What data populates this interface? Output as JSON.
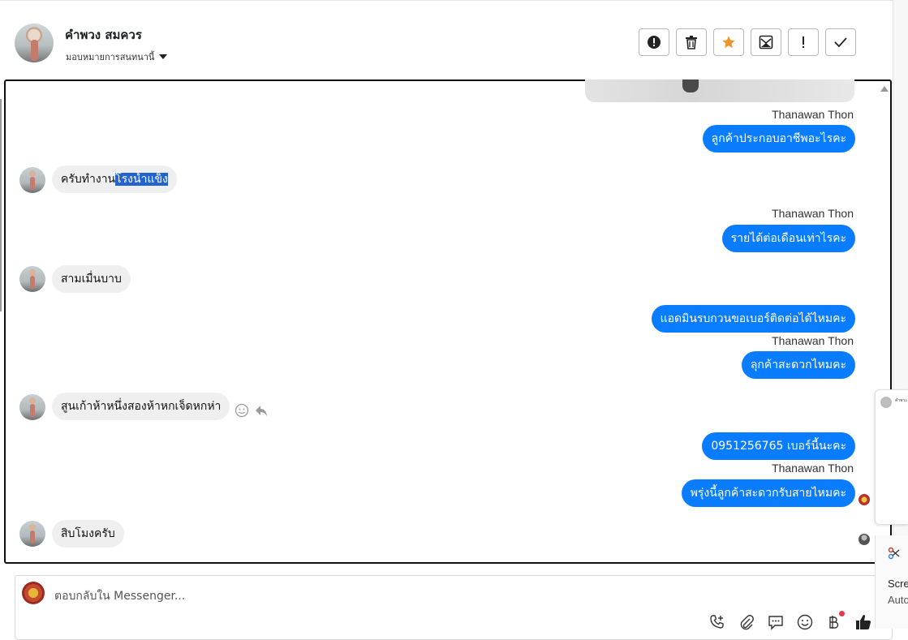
{
  "header": {
    "contact_name": "คำพวง สมควร",
    "assign_label": "มอบหมายการสนทนานี้",
    "toolbar": [
      {
        "name": "report-icon",
        "label": "!"
      },
      {
        "name": "trash-icon"
      },
      {
        "name": "star-icon",
        "color": "#f0932b"
      },
      {
        "name": "mark-unread-icon"
      },
      {
        "name": "exclamation-icon",
        "label": "!"
      },
      {
        "name": "check-icon"
      }
    ]
  },
  "messages": [
    {
      "type": "image",
      "direction": "out"
    },
    {
      "direction": "out",
      "sender": "Thanawan Thon",
      "text": "ลูกค้าประกอบอาชีพอะไรคะ"
    },
    {
      "direction": "in",
      "text_before": "ครับทำงาน",
      "text_selected": "โรงน้ำแข็ง"
    },
    {
      "direction": "out",
      "sender": "Thanawan Thon",
      "text": "รายได้ต่อเดือนเท่าไรคะ"
    },
    {
      "direction": "in",
      "text": "สามเมื่นบาบ"
    },
    {
      "direction": "out",
      "text": "แอดมินรบกวนขอเบอร์ติดต่อได้ไหมคะ"
    },
    {
      "direction": "out",
      "sender": "Thanawan Thon",
      "text": "ลุกค้าสะดวกไหมคะ"
    },
    {
      "direction": "in",
      "text": "สูนเก้าห้าหนึ่งสองห้าหกเจ็ดหกห่า"
    },
    {
      "direction": "out",
      "text": "0951256765 เบอร์นี้นะคะ"
    },
    {
      "direction": "out",
      "sender": "Thanawan Thon",
      "text": "พรุ่งนี้ลูกค้าสะดวกรับสายไหมคะ"
    },
    {
      "direction": "in",
      "text": "สิบโมงครับ"
    }
  ],
  "reply": {
    "placeholder": "ตอบกลับใน Messenger..."
  },
  "side_popup": {
    "title": "คำพวง",
    "snip_title": "Scre",
    "snip_sub": "Auto"
  },
  "colors": {
    "outgoing_bubble": "#0a7cff",
    "incoming_bubble": "#efefef",
    "selection": "#2364d2",
    "star": "#f0932b"
  }
}
